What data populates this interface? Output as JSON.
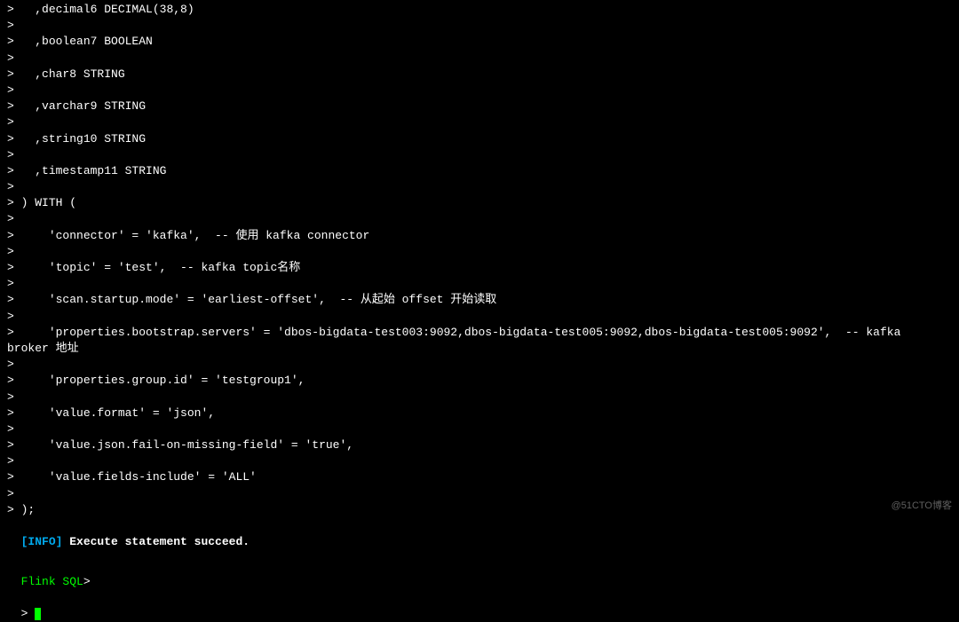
{
  "terminal": {
    "lines": [
      {
        "prompt": true,
        "text": "   ,decimal6 DECIMAL(38,8)"
      },
      {
        "prompt": true,
        "text": ""
      },
      {
        "prompt": true,
        "text": "   ,boolean7 BOOLEAN"
      },
      {
        "prompt": true,
        "text": ""
      },
      {
        "prompt": true,
        "text": "   ,char8 STRING"
      },
      {
        "prompt": true,
        "text": ""
      },
      {
        "prompt": true,
        "text": "   ,varchar9 STRING"
      },
      {
        "prompt": true,
        "text": ""
      },
      {
        "prompt": true,
        "text": "   ,string10 STRING"
      },
      {
        "prompt": true,
        "text": ""
      },
      {
        "prompt": true,
        "text": "   ,timestamp11 STRING"
      },
      {
        "prompt": true,
        "text": ""
      },
      {
        "prompt": true,
        "text": " ) WITH ("
      },
      {
        "prompt": true,
        "text": ""
      },
      {
        "prompt": true,
        "text": "     'connector' = 'kafka',  -- 使用 kafka connector"
      },
      {
        "prompt": true,
        "text": ""
      },
      {
        "prompt": true,
        "text": "     'topic' = 'test',  -- kafka topic名称"
      },
      {
        "prompt": true,
        "text": ""
      },
      {
        "prompt": true,
        "text": "     'scan.startup.mode' = 'earliest-offset',  -- 从起始 offset 开始读取"
      },
      {
        "prompt": true,
        "text": ""
      },
      {
        "prompt": true,
        "text": "     'properties.bootstrap.servers' = 'dbos-bigdata-test003:9092,dbos-bigdata-test005:9092,dbos-bigdata-test005:9092',  -- kafka"
      },
      {
        "prompt": false,
        "text": "broker 地址"
      },
      {
        "prompt": true,
        "text": ""
      },
      {
        "prompt": true,
        "text": "     'properties.group.id' = 'testgroup1',"
      },
      {
        "prompt": true,
        "text": ""
      },
      {
        "prompt": true,
        "text": "     'value.format' = 'json',"
      },
      {
        "prompt": true,
        "text": ""
      },
      {
        "prompt": true,
        "text": "     'value.json.fail-on-missing-field' = 'true',"
      },
      {
        "prompt": true,
        "text": ""
      },
      {
        "prompt": true,
        "text": "     'value.fields-include' = 'ALL'"
      },
      {
        "prompt": true,
        "text": ""
      },
      {
        "prompt": true,
        "text": " );"
      }
    ],
    "info": {
      "tag": "[INFO]",
      "msg": " Execute statement succeed."
    },
    "flink_prompt": "Flink SQL",
    "final_prompt": "> ",
    "watermark": "@51CTO博客"
  }
}
